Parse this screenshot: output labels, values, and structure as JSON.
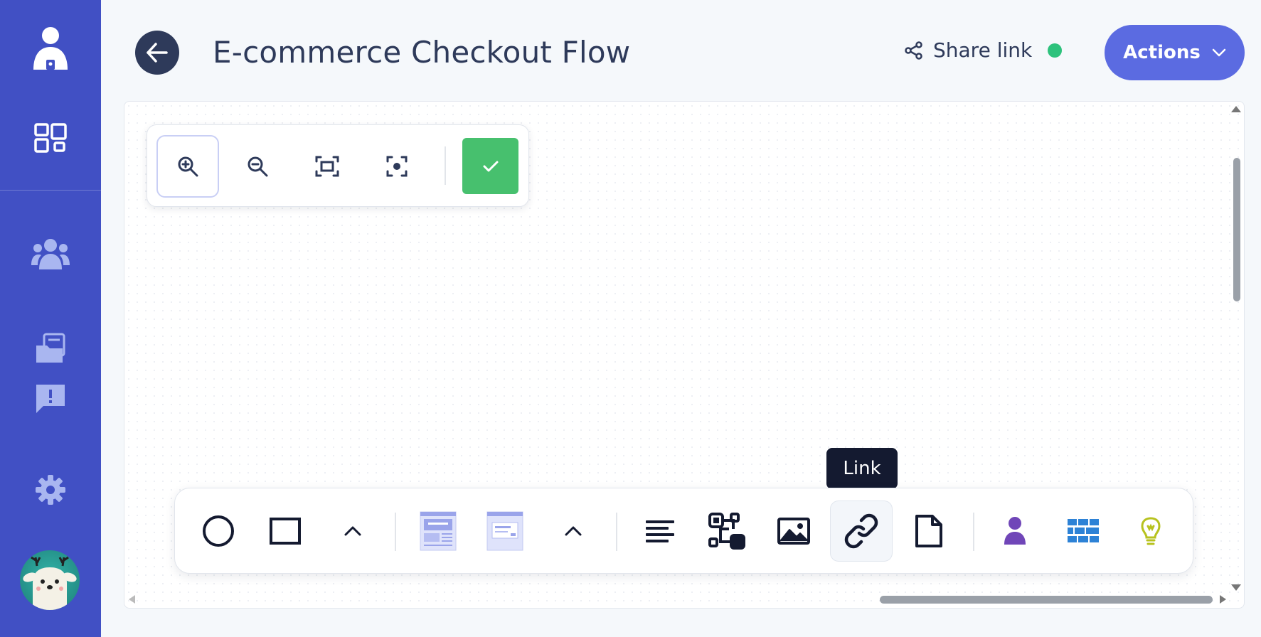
{
  "sidebar": {
    "items": [
      {
        "icon": "user-icon"
      },
      {
        "icon": "dashboard-icon"
      },
      {
        "icon": "team-icon"
      },
      {
        "icon": "documents-icon"
      },
      {
        "icon": "feedback-icon"
      },
      {
        "icon": "settings-icon"
      }
    ],
    "avatar": "deer-avatar"
  },
  "header": {
    "title": "E-commerce Checkout Flow",
    "share_label": "Share link",
    "status_color": "#2dc27c",
    "actions_label": "Actions"
  },
  "zoom_toolbar": {
    "buttons": [
      "zoom-in-icon",
      "zoom-out-icon",
      "fit-screen-icon",
      "focus-icon"
    ],
    "confirm_icon": "check-icon"
  },
  "bottom_toolbar": {
    "tools": [
      "circle-icon",
      "rectangle-icon",
      "chevron-up-icon",
      "wireframe-page-icon",
      "wireframe-dialog-icon",
      "chevron-up-icon",
      "text-icon",
      "flow-icon",
      "image-icon",
      "link-icon",
      "file-icon",
      "person-icon",
      "grid-table-icon",
      "lightbulb-icon"
    ],
    "tooltip": "Link"
  },
  "colors": {
    "sidebar": "#4150c4",
    "accent": "#5b6be1",
    "confirm": "#47c06e"
  }
}
